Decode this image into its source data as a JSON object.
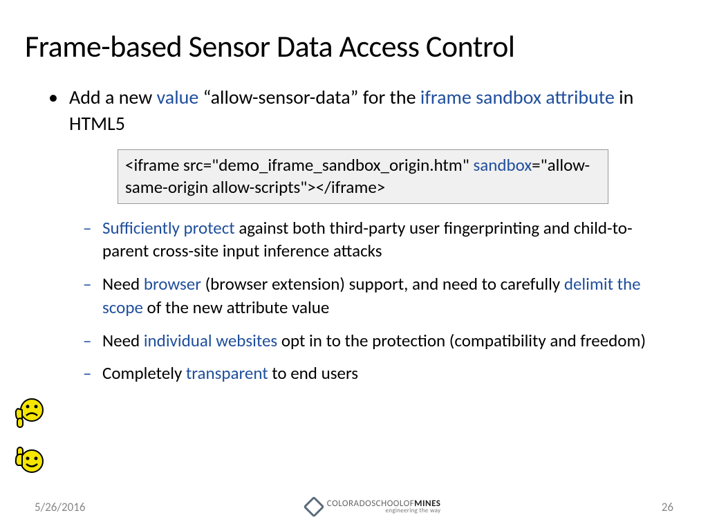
{
  "title": "Frame-based Sensor Data Access Control",
  "bullet1": {
    "p1": "Add a new ",
    "value": "value",
    "p2": " “allow-sensor-data” for the ",
    "iframe": "iframe sandbox attribute",
    "p3": " in HTML5"
  },
  "code": {
    "p1": "<iframe src=\"demo_iframe_sandbox_origin.htm\" ",
    "sandbox": "sandbox",
    "p2": "=\"allow-same-origin allow-scripts\"></iframe>"
  },
  "sub1": {
    "a": "Sufficiently protect",
    "b": " against both third-party user fingerprinting and child-to-parent cross-site input inference attacks"
  },
  "sub2": {
    "a": "Need ",
    "b": "browser",
    "c": " (browser extension) support, and need to carefully ",
    "d": "delimit the scope",
    "e": " of the new attribute value"
  },
  "sub3": {
    "a": "Need ",
    "b": "individual websites",
    "c": " opt in to the protection (compatibility and freedom)"
  },
  "sub4": {
    "a": "Completely ",
    "b": "transparent",
    "c": " to end users"
  },
  "footer": {
    "date": "5/26/2016",
    "page": "26",
    "logo1a": "COLORADO",
    "logo1b": "SCHOOLOF",
    "logo1c": "MINES",
    "logo2": "engineering the way"
  }
}
